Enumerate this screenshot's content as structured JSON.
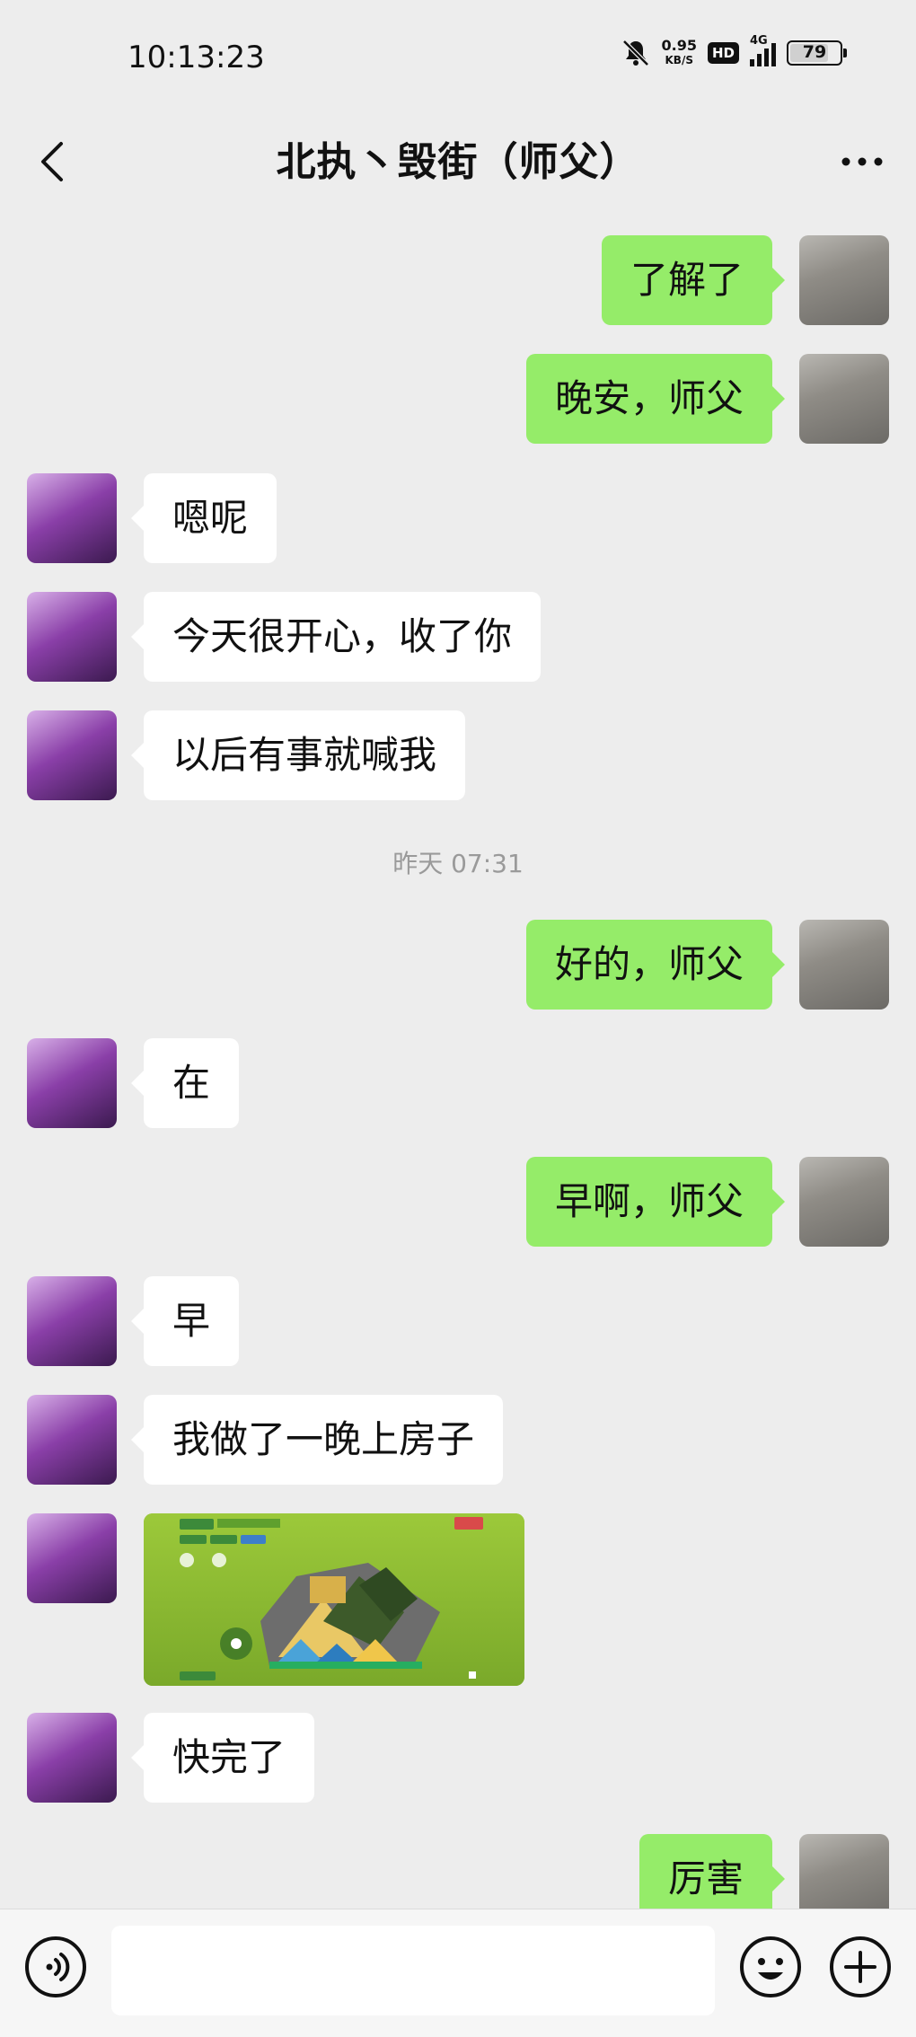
{
  "status_bar": {
    "time": "10:13:23",
    "speed_value": "0.95",
    "speed_unit": "KB/S",
    "hd": "HD",
    "network": "4G",
    "battery": "79",
    "battery_level": 0.79
  },
  "header": {
    "title": "北执丶毁街（师父）"
  },
  "messages": [
    {
      "sender": "me",
      "text": "了解了"
    },
    {
      "sender": "me",
      "text": "晚安，师父"
    },
    {
      "sender": "friend",
      "text": "嗯呢"
    },
    {
      "sender": "friend",
      "text": "今天很开心，收了你"
    },
    {
      "sender": "friend",
      "text": "以后有事就喊我"
    },
    {
      "timestamp": "昨天 07:31"
    },
    {
      "sender": "me",
      "text": "好的，师父"
    },
    {
      "sender": "friend",
      "text": "在"
    },
    {
      "sender": "me",
      "text": "早啊，师父"
    },
    {
      "sender": "friend",
      "text": "早"
    },
    {
      "sender": "friend",
      "text": "我做了一晚上房子"
    },
    {
      "sender": "friend",
      "image": "game-screenshot"
    },
    {
      "sender": "friend",
      "text": "快完了"
    },
    {
      "sender": "me",
      "text": "厉害"
    }
  ],
  "input_bar": {
    "voice_icon": "voice-icon",
    "emoji_icon": "emoji-icon",
    "plus_icon": "plus-icon",
    "value": ""
  },
  "colors": {
    "background": "#ededed",
    "my_bubble": "#95ec69",
    "friend_bubble": "#ffffff",
    "timestamp_text": "#9a9a9a"
  }
}
